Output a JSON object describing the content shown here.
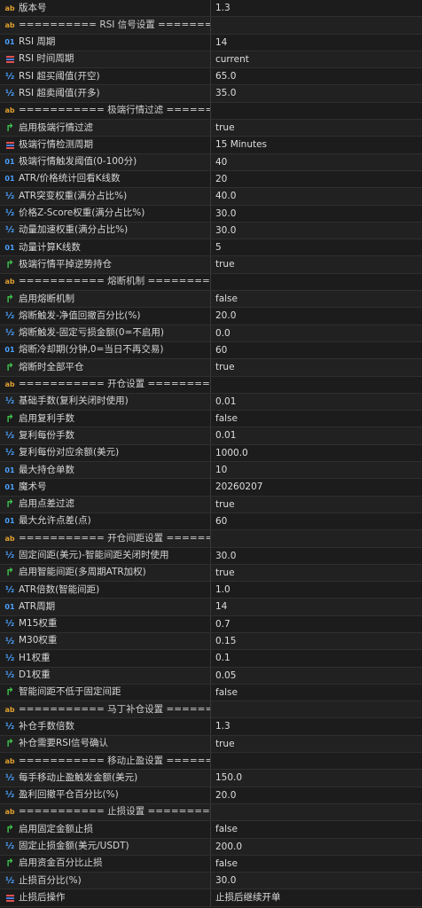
{
  "rows": [
    {
      "type": "string",
      "name": "版本号",
      "value": "1.3"
    },
    {
      "type": "string",
      "name": "========== RSI 信号设置 ==========...",
      "value": ""
    },
    {
      "type": "int",
      "name": "RSI 周期",
      "value": "14"
    },
    {
      "type": "enum",
      "name": "RSI 时间周期",
      "value": "current"
    },
    {
      "type": "double",
      "name": "RSI 超买阈值(开空)",
      "value": "65.0"
    },
    {
      "type": "double",
      "name": "RSI 超卖阈值(开多)",
      "value": "35.0"
    },
    {
      "type": "string",
      "name": "=========== 极端行情过滤 ==========...",
      "value": ""
    },
    {
      "type": "bool",
      "name": "启用极端行情过滤",
      "value": "true"
    },
    {
      "type": "enum",
      "name": "极端行情检测周期",
      "value": "15 Minutes"
    },
    {
      "type": "int",
      "name": "极端行情触发阈值(0-100分)",
      "value": "40"
    },
    {
      "type": "int",
      "name": "ATR/价格统计回看K线数",
      "value": "20"
    },
    {
      "type": "double",
      "name": "ATR突变权重(满分占比%)",
      "value": "40.0"
    },
    {
      "type": "double",
      "name": "价格Z-Score权重(满分占比%)",
      "value": "30.0"
    },
    {
      "type": "double",
      "name": "动量加速权重(满分占比%)",
      "value": "30.0"
    },
    {
      "type": "int",
      "name": "动量计算K线数",
      "value": "5"
    },
    {
      "type": "bool",
      "name": "极端行情平掉逆势持仓",
      "value": "true"
    },
    {
      "type": "string",
      "name": "=========== 熔断机制 ===========",
      "value": ""
    },
    {
      "type": "bool",
      "name": "启用熔断机制",
      "value": "false"
    },
    {
      "type": "double",
      "name": "熔断触发-净值回撤百分比(%)",
      "value": "20.0"
    },
    {
      "type": "double",
      "name": "熔断触发-固定亏损金额(0=不启用)",
      "value": "0.0"
    },
    {
      "type": "int",
      "name": "熔断冷却期(分钟,0=当日不再交易)",
      "value": "60"
    },
    {
      "type": "bool",
      "name": "熔断时全部平仓",
      "value": "true"
    },
    {
      "type": "string",
      "name": "=========== 开仓设置 ===========",
      "value": ""
    },
    {
      "type": "double",
      "name": "基础手数(复利关闭时使用)",
      "value": "0.01"
    },
    {
      "type": "bool",
      "name": "启用复利手数",
      "value": "false"
    },
    {
      "type": "double",
      "name": "复利每份手数",
      "value": "0.01"
    },
    {
      "type": "double",
      "name": "复利每份对应余额(美元)",
      "value": "1000.0"
    },
    {
      "type": "int",
      "name": "最大持仓单数",
      "value": "10"
    },
    {
      "type": "int",
      "name": "魔术号",
      "value": "20260207"
    },
    {
      "type": "bool",
      "name": "启用点差过滤",
      "value": "true"
    },
    {
      "type": "int",
      "name": "最大允许点差(点)",
      "value": "60"
    },
    {
      "type": "string",
      "name": "=========== 开仓间距设置 ==========...",
      "value": ""
    },
    {
      "type": "double",
      "name": "固定间距(美元)-智能间距关闭时使用",
      "value": "30.0"
    },
    {
      "type": "bool",
      "name": "启用智能间距(多周期ATR加权)",
      "value": "true"
    },
    {
      "type": "double",
      "name": "ATR倍数(智能间距)",
      "value": "1.0"
    },
    {
      "type": "int",
      "name": "ATR周期",
      "value": "14"
    },
    {
      "type": "double",
      "name": "M15权重",
      "value": "0.7"
    },
    {
      "type": "double",
      "name": "M30权重",
      "value": "0.15"
    },
    {
      "type": "double",
      "name": "H1权重",
      "value": "0.1"
    },
    {
      "type": "double",
      "name": "D1权重",
      "value": "0.05"
    },
    {
      "type": "bool",
      "name": "智能间距不低于固定间距",
      "value": "false"
    },
    {
      "type": "string",
      "name": "=========== 马丁补仓设置 ==========...",
      "value": ""
    },
    {
      "type": "double",
      "name": "补仓手数倍数",
      "value": "1.3"
    },
    {
      "type": "bool",
      "name": "补仓需要RSI信号确认",
      "value": "true"
    },
    {
      "type": "string",
      "name": "=========== 移动止盈设置 ==========...",
      "value": ""
    },
    {
      "type": "double",
      "name": "每手移动止盈触发金额(美元)",
      "value": "150.0"
    },
    {
      "type": "double",
      "name": "盈利回撤平仓百分比(%)",
      "value": "20.0"
    },
    {
      "type": "string",
      "name": "=========== 止损设置 ===========",
      "value": ""
    },
    {
      "type": "bool",
      "name": "启用固定金额止损",
      "value": "false"
    },
    {
      "type": "double",
      "name": "固定止损金额(美元/USDT)",
      "value": "200.0"
    },
    {
      "type": "bool",
      "name": "启用资金百分比止损",
      "value": "false"
    },
    {
      "type": "double",
      "name": "止损百分比(%)",
      "value": "30.0"
    },
    {
      "type": "enum",
      "name": "止损后操作",
      "value": "止损后继续开单"
    }
  ],
  "icons": {
    "string": "ab",
    "int": "01",
    "double": "½",
    "bool": "↱"
  },
  "colors": {
    "background": "#1c1c1c",
    "grid_line": "#2f2f2f",
    "int_icon": "#4aa0ff",
    "bool_icon": "#3ec24c",
    "string_icon": "#e0a030"
  }
}
